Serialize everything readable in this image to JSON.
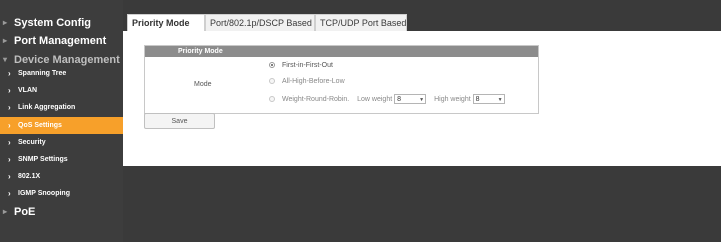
{
  "sidebar": {
    "items": [
      {
        "label": "System Config",
        "level": "top"
      },
      {
        "label": "Port Management",
        "level": "top"
      },
      {
        "label": "Device Management",
        "level": "top",
        "open": true
      },
      {
        "label": "Spanning Tree",
        "level": "sub"
      },
      {
        "label": "VLAN",
        "level": "sub"
      },
      {
        "label": "Link Aggregation",
        "level": "sub"
      },
      {
        "label": "QoS Settings",
        "level": "sub",
        "active": true
      },
      {
        "label": "Security",
        "level": "sub"
      },
      {
        "label": "SNMP Settings",
        "level": "sub"
      },
      {
        "label": "802.1X",
        "level": "sub"
      },
      {
        "label": "IGMP Snooping",
        "level": "sub"
      },
      {
        "label": "PoE",
        "level": "top"
      }
    ],
    "active_color": "#f7a02a"
  },
  "tabs": [
    {
      "label": "Priority Mode",
      "active": true
    },
    {
      "label": "Port/802.1p/DSCP Based",
      "active": false
    },
    {
      "label": "TCP/UDP Port Based",
      "active": false
    }
  ],
  "panel": {
    "title": "Priority Mode",
    "mode_label": "Mode",
    "options": [
      {
        "label": "First-in-First-Out",
        "selected": true
      },
      {
        "label": "All-High-Before-Low",
        "selected": false
      },
      {
        "label": "Weight-Round-Robin.",
        "selected": false
      }
    ],
    "low_weight_label": "Low weight",
    "low_weight_value": "8",
    "high_weight_label": "High weight",
    "high_weight_value": "8"
  },
  "save_label": "Save"
}
